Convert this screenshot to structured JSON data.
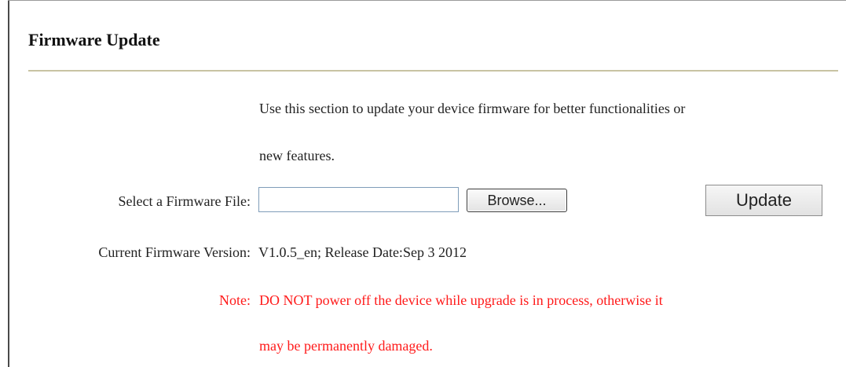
{
  "page": {
    "title": "Firmware Update",
    "description_line1": "Use this section to update your device firmware for better functionalities or",
    "description_line2": "new features."
  },
  "firmware_file": {
    "label": "Select a Firmware File:",
    "value": "",
    "browse_label": "Browse...",
    "update_label": "Update"
  },
  "current_version": {
    "label": "Current Firmware Version:",
    "value": "V1.0.5_en; Release Date:Sep 3 2012"
  },
  "note": {
    "label": "Note:",
    "line1": "DO NOT power off the device while upgrade is in process, otherwise it",
    "line2": "may be permanently damaged.",
    "color": "#ff1a1a"
  }
}
